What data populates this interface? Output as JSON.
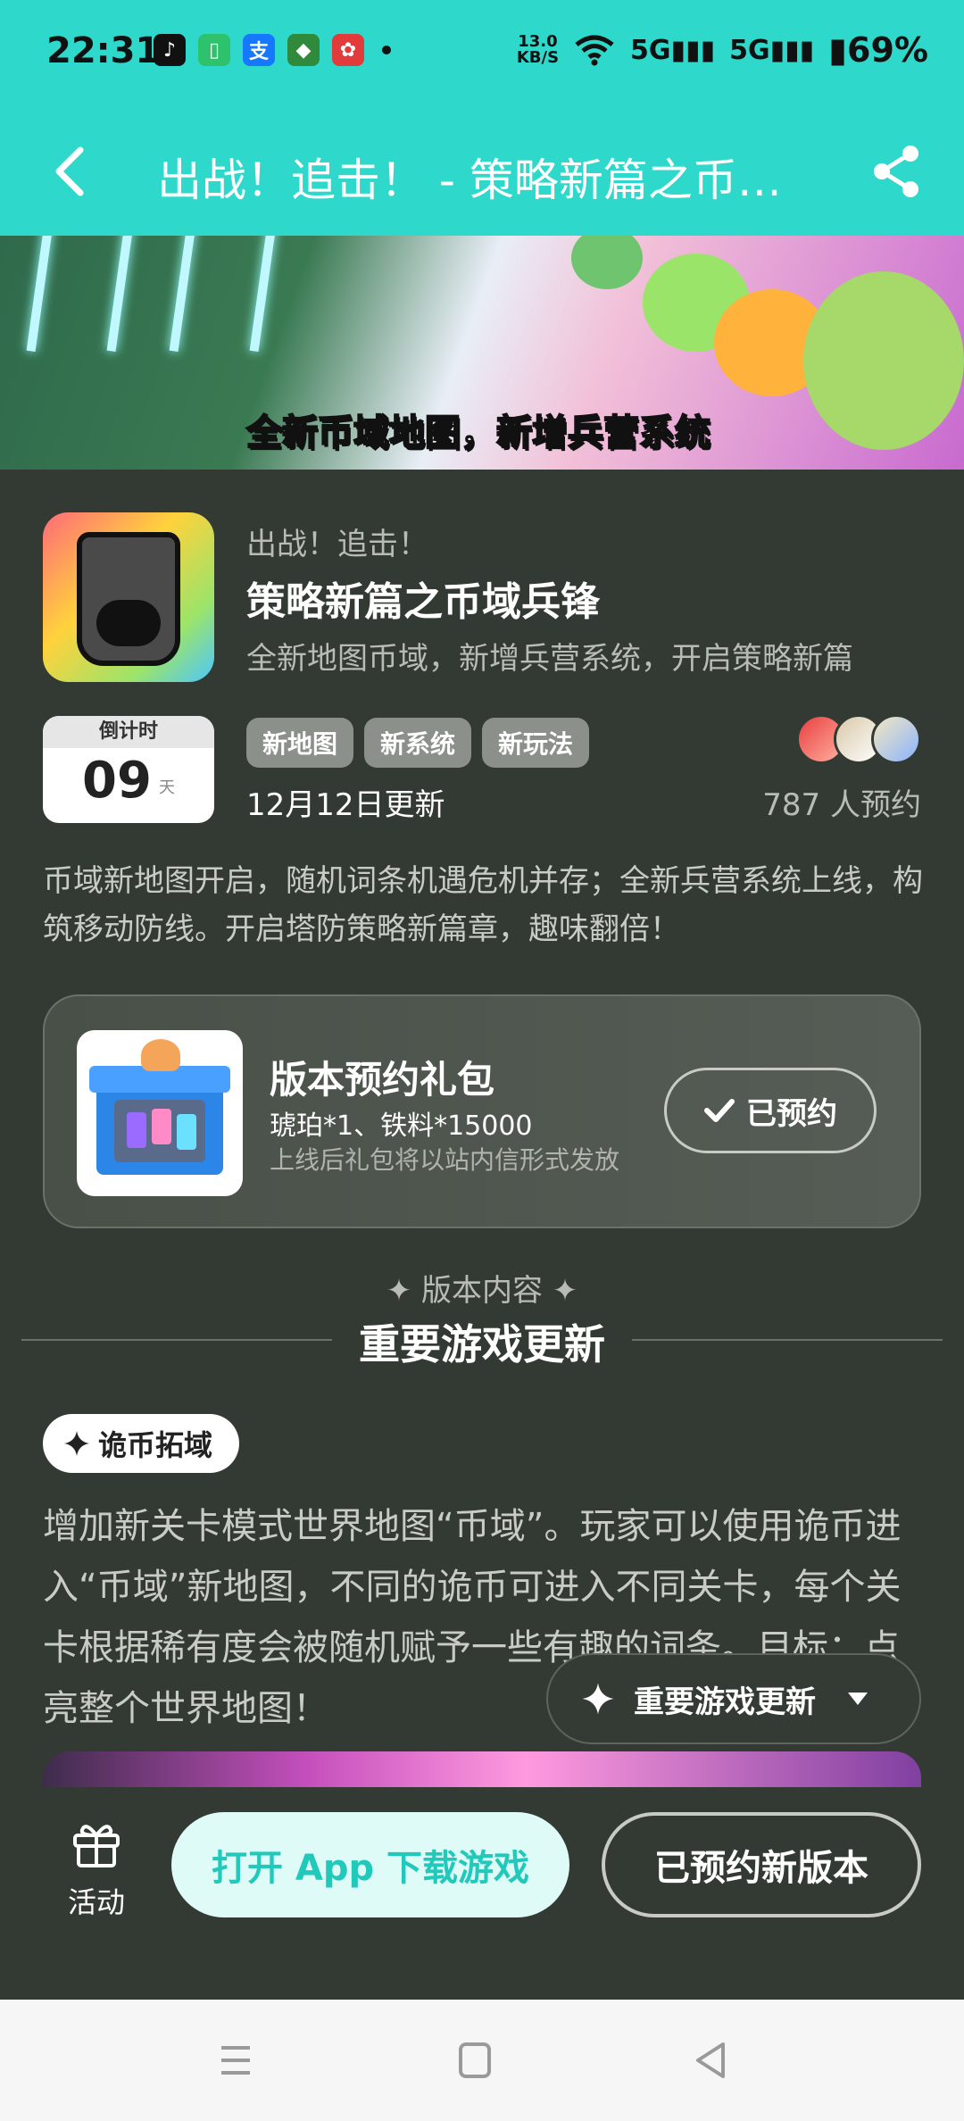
{
  "status_bar": {
    "time": "22:31",
    "net_speed_value": "13.0",
    "net_speed_unit": "KB/S",
    "signal1": "5G",
    "signal2": "5G",
    "battery": "69%"
  },
  "title_bar": {
    "title": "出战！追击！ - 策略新篇之币域兵锋"
  },
  "banner": {
    "caption": "全新币域地图，新增兵营系统"
  },
  "header": {
    "subtitle": "出战！追击！",
    "title": "策略新篇之币域兵锋",
    "description": "全新地图币域，新增兵营系统，开启策略新篇",
    "countdown_label": "倒计时",
    "countdown_value": "09",
    "countdown_unit": "天",
    "tags": [
      "新地图",
      "新系统",
      "新玩法"
    ],
    "updated": "12月12日更新",
    "reservations": "787 人预约"
  },
  "intro": "币域新地图开启，随机词条机遇危机并存；全新兵营系统上线，构筑移动防线。开启塔防策略新篇章，趣味翻倍！",
  "gift": {
    "title": "版本预约礼包",
    "items": "琥珀*1、铁料*15000",
    "note": "上线后礼包将以站内信形式发放",
    "button": "已预约"
  },
  "section": {
    "small": "✦ 版本内容 ✦",
    "big": "重要游戏更新"
  },
  "feature": {
    "pill": "诡币拓域",
    "body": "增加新关卡模式世界地图“币域”。玩家可以使用诡币进入“币域”新地图，不同的诡币可进入不同关卡，每个关卡根据稀有度会被随机赋予一些有趣的词条。目标：点亮整个世界地图！"
  },
  "floating_nav": {
    "label": "重要游戏更新"
  },
  "bottom_bar": {
    "activity_label": "活动",
    "open_button": "打开 App 下载游戏",
    "reserved_button": "已预约新版本"
  },
  "colors": {
    "accent": "#2ed8cb",
    "background": "#333a33",
    "open_button_bg": "#dffbf8",
    "open_button_text": "#21c9bb"
  }
}
